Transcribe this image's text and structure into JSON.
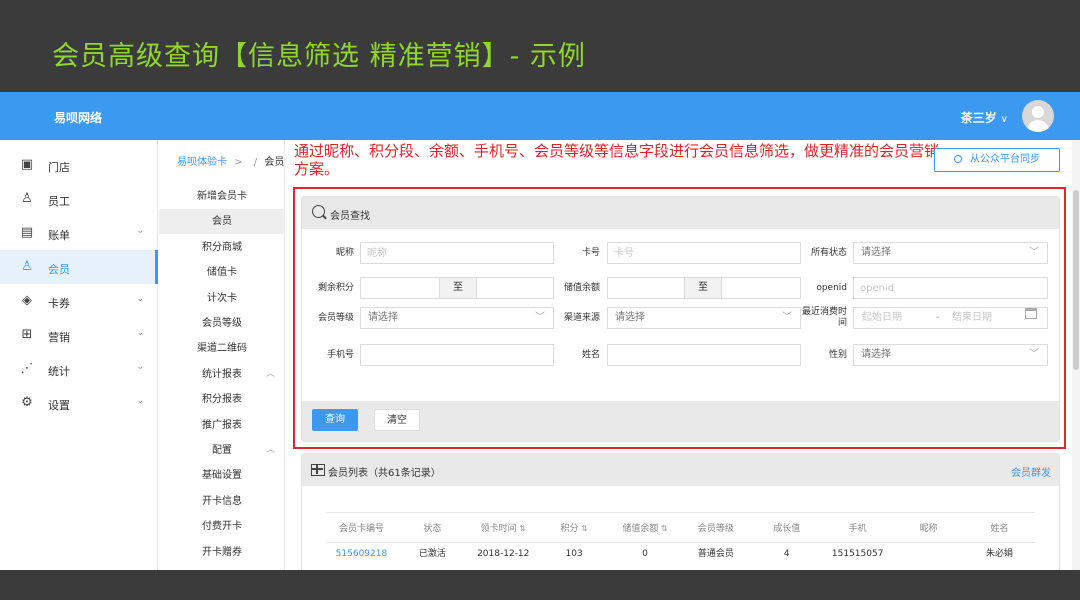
{
  "slide": {
    "title": "会员高级查询【信息筛选 精准营销】- 示例"
  },
  "topbar": {
    "brand": "易呗网络",
    "user_name": "茶三岁",
    "user_chevron": "∨"
  },
  "sidebar": {
    "items": [
      {
        "label": "门店",
        "icon": "store-icon",
        "glyph": "▣",
        "arrow": ""
      },
      {
        "label": "员工",
        "icon": "staff-icon",
        "glyph": "♙",
        "arrow": ""
      },
      {
        "label": "账单",
        "icon": "bill-icon",
        "glyph": "▤",
        "arrow": "⌄"
      },
      {
        "label": "会员",
        "icon": "member-icon",
        "glyph": "♙",
        "arrow": ""
      },
      {
        "label": "卡券",
        "icon": "coupon-icon",
        "glyph": "◈",
        "arrow": "⌄"
      },
      {
        "label": "营销",
        "icon": "gift-icon",
        "glyph": "⊞",
        "arrow": "⌄"
      },
      {
        "label": "统计",
        "icon": "stats-icon",
        "glyph": "⋰",
        "arrow": "⌄"
      },
      {
        "label": "设置",
        "icon": "settings-icon",
        "glyph": "⚙",
        "arrow": "⌄"
      }
    ],
    "active_index": 3
  },
  "breadcrumb": {
    "root": "易呗体验卡",
    "sep1": ">",
    "sep2": "/",
    "current": "会员"
  },
  "subnav": {
    "items": [
      {
        "label": "新增会员卡",
        "toggle": ""
      },
      {
        "label": "会员",
        "toggle": ""
      },
      {
        "label": "积分商城",
        "toggle": ""
      },
      {
        "label": "储值卡",
        "toggle": ""
      },
      {
        "label": "计次卡",
        "toggle": ""
      },
      {
        "label": "会员等级",
        "toggle": ""
      },
      {
        "label": "渠道二维码",
        "toggle": ""
      },
      {
        "label": "统计报表",
        "toggle": "︿"
      },
      {
        "label": "积分报表",
        "toggle": ""
      },
      {
        "label": "推广报表",
        "toggle": ""
      },
      {
        "label": "配置",
        "toggle": "︿"
      },
      {
        "label": "基础设置",
        "toggle": ""
      },
      {
        "label": "开卡信息",
        "toggle": ""
      },
      {
        "label": "付费开卡",
        "toggle": ""
      },
      {
        "label": "开卡赠券",
        "toggle": ""
      }
    ],
    "active_index": 1
  },
  "callout": "通过昵称、积分段、余额、手机号、会员等级等信息字段进行会员信息筛选，做更精准的会员营销方案。",
  "sync_button": "从公众平台同步",
  "query": {
    "title": "会员查找",
    "nickname": {
      "label": "昵称",
      "placeholder": "昵称"
    },
    "card_no": {
      "label": "卡号",
      "placeholder": "卡号"
    },
    "status": {
      "label": "所有状态",
      "value": "请选择"
    },
    "points": {
      "label": "剩余积分",
      "to": "至"
    },
    "balance": {
      "label": "储值余额",
      "to": "至"
    },
    "openid": {
      "label": "openid",
      "placeholder": "openid"
    },
    "level": {
      "label": "会员等级",
      "value": "请选择"
    },
    "channel": {
      "label": "渠道来源",
      "value": "请选择"
    },
    "last_spend": {
      "label": "最近消费时间",
      "start": "起始日期",
      "dash": "-",
      "end": "结束日期"
    },
    "phone": {
      "label": "手机号"
    },
    "name": {
      "label": "姓名"
    },
    "gender": {
      "label": "性别",
      "value": "请选择"
    },
    "search_button": "查询",
    "clear_button": "清空"
  },
  "member_list": {
    "title": "会员列表（共61条记录）",
    "mass_send": "会员群发",
    "columns": [
      "会员卡编号",
      "状态",
      "领卡时间",
      "积分",
      "储值余额",
      "会员等级",
      "成长值",
      "手机",
      "昵称",
      "姓名"
    ],
    "sortable": [
      false,
      false,
      true,
      true,
      true,
      false,
      false,
      false,
      false,
      false
    ],
    "rows": [
      [
        "515609218",
        "已激活",
        "2018-12-12",
        "103",
        "0",
        "普通会员",
        "4",
        "151515057",
        "",
        "朱必娟"
      ]
    ]
  }
}
